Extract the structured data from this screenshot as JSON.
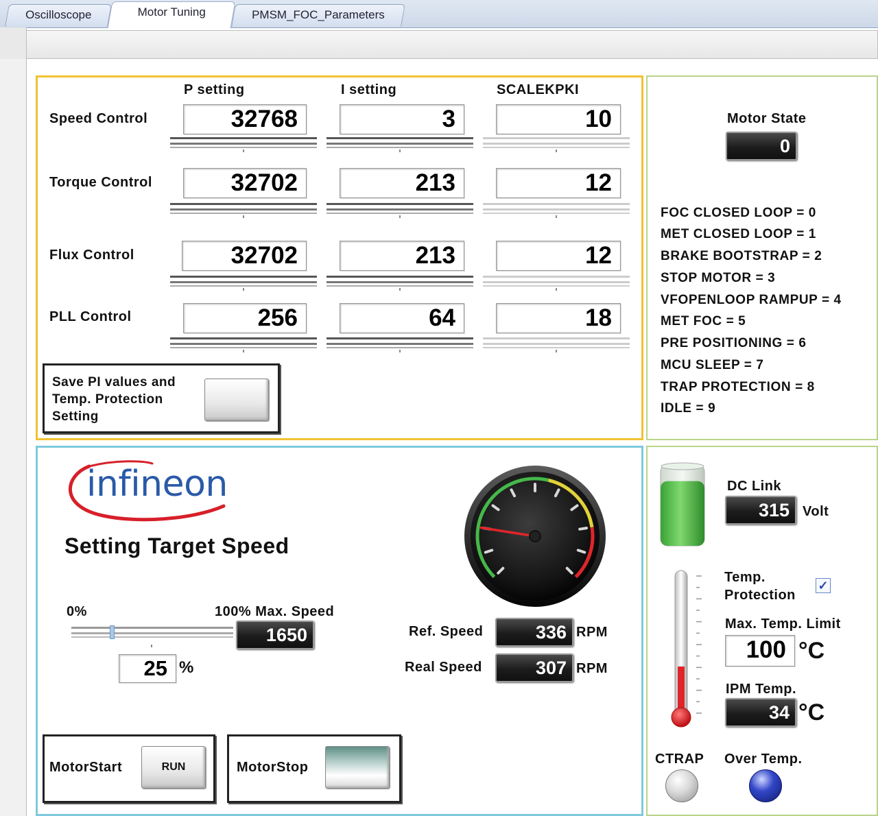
{
  "tabs": [
    "Oscilloscope",
    "Motor Tuning",
    "PMSM_FOC_Parameters"
  ],
  "pi": {
    "headers": [
      "P setting",
      "I setting",
      "SCALEKPKI"
    ],
    "rows": [
      {
        "label": "Speed Control",
        "p": "32768",
        "i": "3",
        "scale": "10"
      },
      {
        "label": "Torque Control",
        "p": "32702",
        "i": "213",
        "scale": "12"
      },
      {
        "label": "Flux Control",
        "p": "32702",
        "i": "213",
        "scale": "12"
      },
      {
        "label": "PLL Control",
        "p": "256",
        "i": "64",
        "scale": "18"
      }
    ],
    "save_label_lines": [
      "Save PI values and",
      "Temp. Protection",
      "Setting"
    ]
  },
  "motor_state": {
    "title": "Motor State",
    "value": "0",
    "legend": [
      "FOC CLOSED LOOP = 0",
      "MET CLOSED LOOP = 1",
      "BRAKE BOOTSTRAP = 2",
      "STOP MOTOR = 3",
      "VFOPENLOOP RAMPUP = 4",
      "MET FOC = 5",
      "PRE POSITIONING = 6",
      "MCU SLEEP = 7",
      "TRAP PROTECTION = 8",
      "IDLE = 9"
    ]
  },
  "speed": {
    "logo": "infineon",
    "title": "Setting Target Speed",
    "min_label": "0%",
    "max_label": "100% Max. Speed",
    "max_speed_value": "1650",
    "percent_value": "25",
    "percent_unit": "%",
    "ref_label": "Ref. Speed",
    "ref_value": "336",
    "real_label": "Real Speed",
    "real_value": "307",
    "rpm_unit": "RPM",
    "start_label": "MotorStart",
    "run_label": "RUN",
    "stop_label": "MotorStop",
    "gauge_level": 0.2
  },
  "status": {
    "dc_link_label": "DC Link",
    "dc_link_value": "315",
    "dc_unit": "Volt",
    "tank_level": 0.8,
    "temp_prot_lines": [
      "Temp.",
      "Protection"
    ],
    "temp_prot_checked": true,
    "max_temp_label": "Max. Temp. Limit",
    "max_temp_value": "100",
    "deg_unit": "°C",
    "ipm_label": "IPM Temp.",
    "ipm_value": "34",
    "thermo_level": 0.34,
    "ctrap_label": "CTRAP",
    "overtemp_label": "Over Temp."
  },
  "colors": {
    "pi_border": "#f1c232",
    "speed_border": "#7fc9dd",
    "side_border": "#b9d48a",
    "logo_blue": "#2a5aa8",
    "logo_red": "#d7202a",
    "tank_green": "#4cba45",
    "thermo_red": "#e0252a",
    "led_blue": "#1f2fa8"
  }
}
